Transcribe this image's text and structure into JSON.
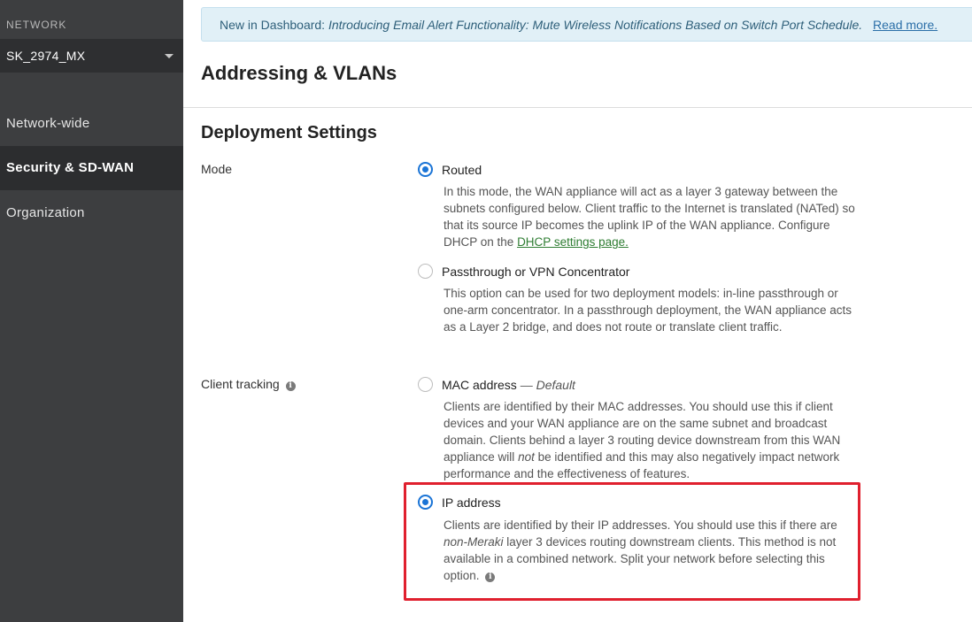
{
  "sidebar": {
    "network_label": "NETWORK",
    "network_name": "SK_2974_MX",
    "items": [
      {
        "label": "Network-wide"
      },
      {
        "label": "Security & SD-WAN"
      },
      {
        "label": "Organization"
      }
    ]
  },
  "banner": {
    "prefix": "New in Dashboard:",
    "message": "Introducing Email Alert Functionality: Mute Wireless Notifications Based on Switch Port Schedule.",
    "link": "Read more."
  },
  "page_title": "Addressing & VLANs",
  "section_title": "Deployment Settings",
  "mode": {
    "label": "Mode",
    "options": [
      {
        "title": "Routed",
        "checked": true,
        "desc": "In this mode, the WAN appliance will act as a layer 3 gateway between the subnets configured below. Client traffic to the Internet is translated (NATed) so that its source IP becomes the uplink IP of the WAN appliance. Configure DHCP on the",
        "link": "DHCP settings page."
      },
      {
        "title": "Passthrough or VPN Concentrator",
        "checked": false,
        "desc": "This option can be used for two deployment models: in-line passthrough or one-arm concentrator. In a passthrough deployment, the WAN appliance acts as a Layer 2 bridge, and does not route or translate client traffic."
      }
    ]
  },
  "client_tracking": {
    "label": "Client tracking",
    "options": [
      {
        "title": "MAC address",
        "default_tag": "— Default",
        "checked": false,
        "desc_1": "Clients are identified by their MAC addresses. You should use this if client devices and your WAN appliance are on the same subnet and broadcast domain. Clients behind a layer 3 routing device downstream from this WAN appliance will",
        "desc_em": "not",
        "desc_2": "be identified and this may also negatively impact network performance and the effectiveness of features."
      },
      {
        "title": "IP address",
        "checked": true,
        "desc_1": "Clients are identified by their IP addresses. You should use this if there are",
        "desc_em": "non-Meraki",
        "desc_2": "layer 3 devices routing downstream clients. This method is not available in a combined network. Split your network before selecting this option."
      }
    ]
  },
  "colors": {
    "sidebar_bg": "#3d3e40",
    "accent_blue": "#1a74d6",
    "highlight_red": "#e0202e",
    "link_green": "#2e7d32"
  }
}
